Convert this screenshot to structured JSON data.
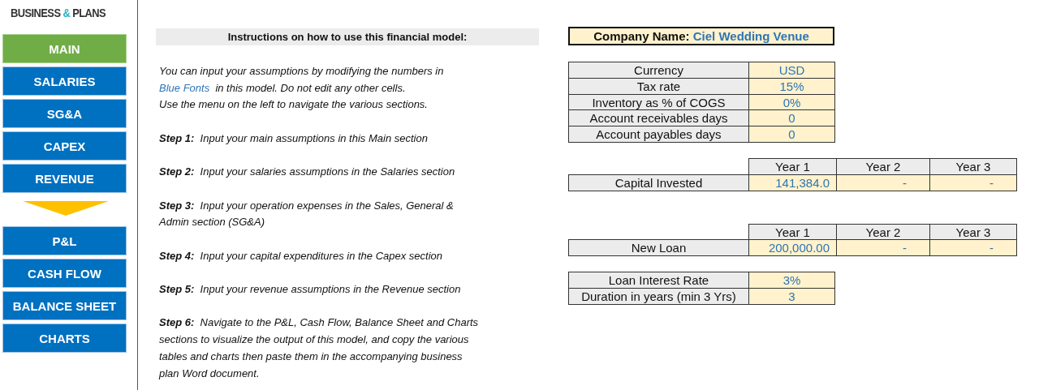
{
  "logo": {
    "first": "BUSINESS",
    "amp": "&",
    "second": "PLANS"
  },
  "nav": {
    "top": [
      {
        "label": "MAIN",
        "selected": true
      },
      {
        "label": "SALARIES",
        "selected": false
      },
      {
        "label": "SG&A",
        "selected": false
      },
      {
        "label": "CAPEX",
        "selected": false
      },
      {
        "label": "REVENUE",
        "selected": false
      }
    ],
    "bottom": [
      {
        "label": "P&L",
        "selected": false
      },
      {
        "label": "CASH FLOW",
        "selected": false
      },
      {
        "label": "BALANCE SHEET",
        "selected": false
      },
      {
        "label": "CHARTS",
        "selected": false
      }
    ]
  },
  "instructions": {
    "title": "Instructions on how to use this financial model:",
    "intro": {
      "before": "You can input your assumptions by modifying the numbers in",
      "highlight": "Blue Fonts",
      "after": "in this model. Do not edit any other cells."
    },
    "note": "Use the menu on the left to navigate the various sections.",
    "steps": [
      {
        "label": "Step 1:",
        "lines": [
          "Input your main assumptions in this Main section"
        ]
      },
      {
        "label": "Step 2:",
        "lines": [
          "Input your salaries assumptions in the Salaries section"
        ]
      },
      {
        "label": "Step 3:",
        "lines": [
          "Input your operation expenses in the Sales, General &",
          "Admin section (SG&A)"
        ]
      },
      {
        "label": "Step 4:",
        "lines": [
          "Input your capital expenditures in the Capex section"
        ]
      },
      {
        "label": "Step 5:",
        "lines": [
          "Input your revenue assumptions in the Revenue section"
        ]
      },
      {
        "label": "Step 6:",
        "lines": [
          "Navigate to the P&L, Cash Flow, Balance Sheet and Charts",
          "sections to visualize the output of this model, and copy the various",
          "tables and charts then paste them in the accompanying business",
          "plan Word document."
        ]
      }
    ]
  },
  "company": {
    "label": "Company Name:",
    "value": "Ciel Wedding Venue"
  },
  "assumptions": [
    {
      "label": "Currency",
      "value": "USD"
    },
    {
      "label": "Tax rate",
      "value": "15%"
    },
    {
      "label": "Inventory as % of COGS",
      "value": "0%"
    },
    {
      "label": "Account receivables days",
      "value": "0"
    },
    {
      "label": "Account payables days",
      "value": "0"
    }
  ],
  "yearly_tables": [
    {
      "columns": [
        "Year 1",
        "Year 2",
        "Year 3"
      ],
      "label": "Capital Invested",
      "values": [
        "141,384.0",
        "-",
        "-"
      ]
    },
    {
      "columns": [
        "Year 1",
        "Year 2",
        "Year 3"
      ],
      "label": "New Loan",
      "values": [
        "200,000.00",
        "-",
        "-"
      ]
    }
  ],
  "loan_terms": [
    {
      "label": "Loan Interest Rate",
      "value": "3%"
    },
    {
      "label": "Duration in years (min 3 Yrs)",
      "value": "3"
    }
  ]
}
